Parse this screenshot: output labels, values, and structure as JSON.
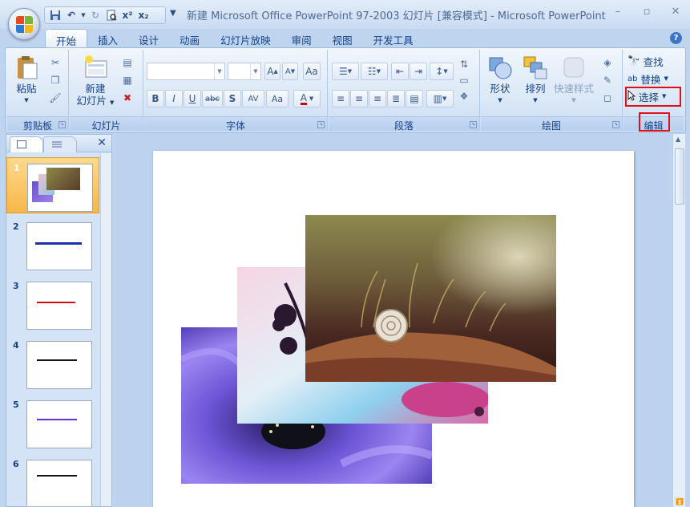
{
  "window": {
    "title": "新建 Microsoft Office PowerPoint 97-2003 幻灯片 [兼容模式] - Microsoft PowerPoint",
    "controls": [
      "minimize-icon",
      "restore-icon",
      "close-icon"
    ]
  },
  "quick_access": {
    "items": [
      "save-icon",
      "undo-icon",
      "redo-icon",
      "print-preview-icon",
      "superscript-icon",
      "subscript-icon"
    ],
    "superscript": "x²",
    "subscript": "x₂"
  },
  "tabs": [
    "开始",
    "插入",
    "设计",
    "动画",
    "幻灯片放映",
    "审阅",
    "视图",
    "开发工具"
  ],
  "active_tab": "开始",
  "ribbon": {
    "clipboard": {
      "label": "剪贴板",
      "paste": "粘贴"
    },
    "slides": {
      "label": "幻灯片",
      "new_slide_line1": "新建",
      "new_slide_line2": "幻灯片"
    },
    "font": {
      "label": "字体",
      "buttons": [
        "B",
        "I",
        "U",
        "abc",
        "S",
        "AV",
        "Aa",
        "A"
      ]
    },
    "paragraph": {
      "label": "段落"
    },
    "drawing": {
      "label": "绘图",
      "shapes": "形状",
      "arrange": "排列",
      "quick_styles": "快速样式"
    },
    "editing": {
      "label": "编辑",
      "find": "查找",
      "replace": "替换",
      "select": "选择"
    }
  },
  "highlight_color": "#e0101a",
  "slide_panel": {
    "slides": [
      {
        "number": "1",
        "selected": true,
        "kind": "images"
      },
      {
        "number": "2",
        "selected": false,
        "kind": "text",
        "text_color": "#1c2fb0"
      },
      {
        "number": "3",
        "selected": false,
        "kind": "text",
        "text_color": "#d01010"
      },
      {
        "number": "4",
        "selected": false,
        "kind": "text",
        "text_color": "#111111"
      },
      {
        "number": "5",
        "selected": false,
        "kind": "text",
        "text_color": "#6a2bd0"
      },
      {
        "number": "6",
        "selected": false,
        "kind": "text",
        "text_color": "#111111"
      }
    ]
  }
}
